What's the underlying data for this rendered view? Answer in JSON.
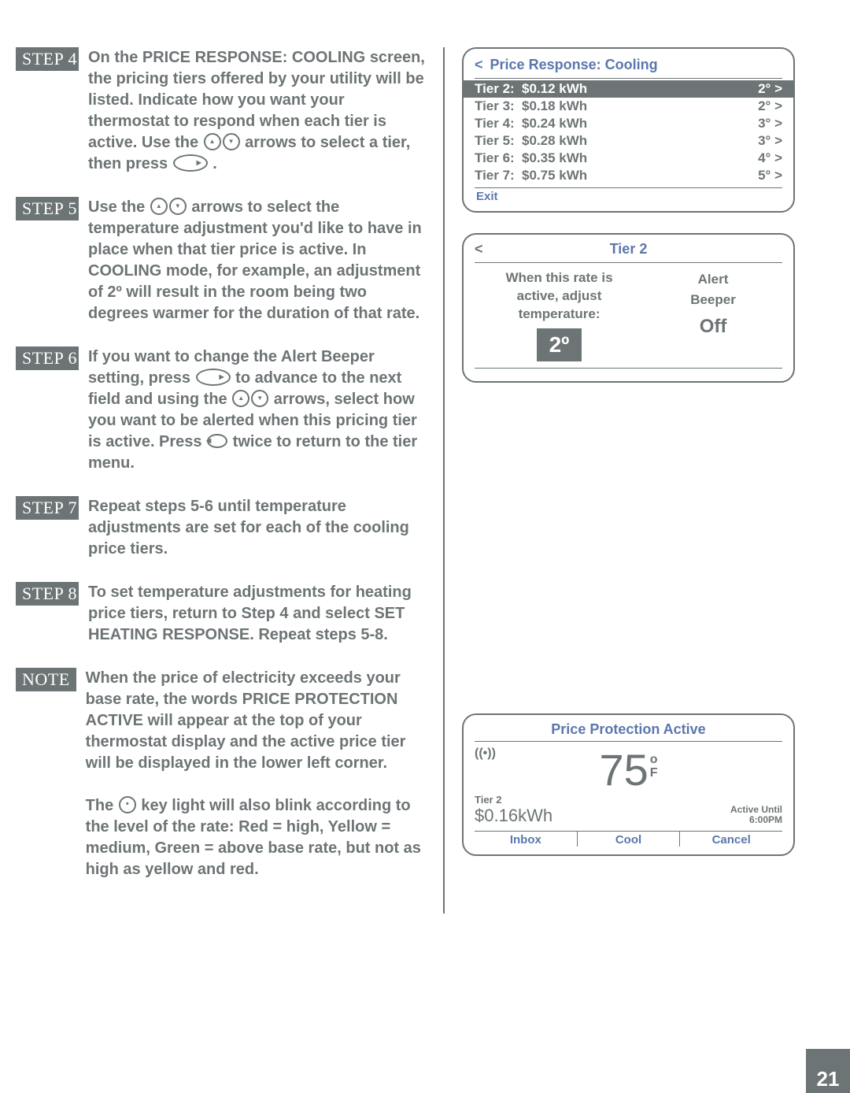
{
  "page_number": "21",
  "steps": [
    {
      "badge": "STEP 4",
      "text": "On the PRICE RESPONSE: COOLING screen, the pricing tiers offered by your utility will be listed. Indicate how you want your thermostat to respond when each tier is active. Use the [up][down] arrows to select a tier, then press [right] ."
    },
    {
      "badge": "STEP 5",
      "text": "Use the [up][down] arrows to select the temperature adjustment you'd like to have in place when that tier price is active. In COOLING mode, for example, an adjustment of 2º will result in the room being two degrees warmer for the duration of that rate."
    },
    {
      "badge": "STEP 6",
      "text": "If you want to change the Alert Beeper setting, press [right] to advance to the next field and using the [up][down] arrows, select how you want to be alerted when this pricing tier is active. Press [left] twice to return to the tier menu."
    },
    {
      "badge": "STEP 7",
      "text": "Repeat steps 5-6 until temperature adjustments are set for each of the cooling price tiers."
    },
    {
      "badge": "STEP 8",
      "text": "To set temperature adjustments for heating price tiers, return to Step 4 and select SET HEATING RESPONSE. Repeat steps 5-8."
    },
    {
      "badge": "NOTE",
      "text": "When the price of electricity exceeds your base rate, the words PRICE PROTECTION ACTIVE will appear at the top of your thermostat display and the active price tier will be displayed in the lower left corner.\nThe [dot] key light will also blink according to the level of the rate: Red = high, Yellow = medium, Green = above base rate, but not as high as yellow and red."
    }
  ],
  "screen_tiers": {
    "title": "Price Response: Cooling",
    "tiers": [
      {
        "label": "Tier 2:",
        "price": "$0.12 kWh",
        "adj": "2° >",
        "selected": true
      },
      {
        "label": "Tier 3:",
        "price": "$0.18 kWh",
        "adj": "2° >",
        "selected": false
      },
      {
        "label": "Tier 4:",
        "price": "$0.24 kWh",
        "adj": "3° >",
        "selected": false
      },
      {
        "label": "Tier 5:",
        "price": "$0.28 kWh",
        "adj": "3° >",
        "selected": false
      },
      {
        "label": "Tier 6:",
        "price": "$0.35 kWh",
        "adj": "4° >",
        "selected": false
      },
      {
        "label": "Tier 7:",
        "price": "$0.75 kWh",
        "adj": "5° >",
        "selected": false
      }
    ],
    "footer": [
      "Exit"
    ]
  },
  "screen_tier_detail": {
    "title": "Tier 2",
    "prompt_line1": "When this rate is",
    "prompt_line2": "active, adjust",
    "prompt_line3": "temperature:",
    "value": "2º",
    "alert_label": "Alert",
    "beeper_label": "Beeper",
    "beeper_value": "Off"
  },
  "screen_protection": {
    "title": "Price Protection Active",
    "signal_icon": "((•))",
    "temperature": "75",
    "temp_unit_deg": "o",
    "temp_unit_f": "F",
    "tier_label": "Tier 2",
    "price": "$0.16",
    "price_unit": "kWh",
    "active_until_label": "Active Until",
    "active_until_value": "6:00PM",
    "footer": [
      "Inbox",
      "Cool",
      "Cancel"
    ]
  }
}
